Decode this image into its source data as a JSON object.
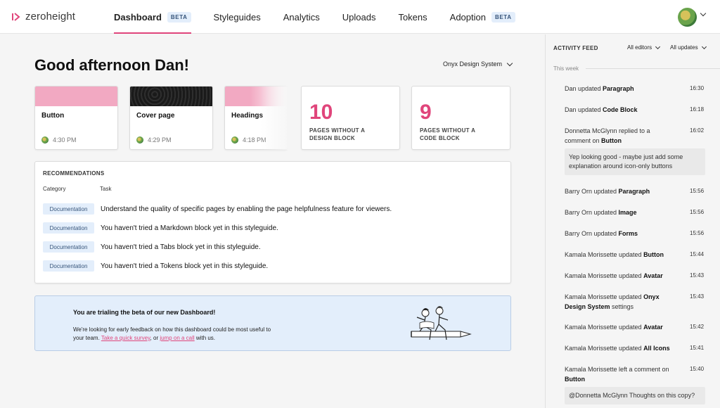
{
  "brand": {
    "name": "zeroheight",
    "accent": "#e0457b"
  },
  "nav": {
    "items": [
      {
        "label": "Dashboard",
        "badge": "BETA",
        "active": true
      },
      {
        "label": "Styleguides",
        "badge": ""
      },
      {
        "label": "Analytics",
        "badge": ""
      },
      {
        "label": "Uploads",
        "badge": ""
      },
      {
        "label": "Tokens",
        "badge": ""
      },
      {
        "label": "Adoption",
        "badge": "BETA"
      }
    ]
  },
  "user": {
    "avatar_icon": "user-avatar"
  },
  "greeting": "Good afternoon Dan!",
  "design_system_select": "Onyx Design System",
  "recent_pages": [
    {
      "title": "Button",
      "time": "4:30 PM",
      "thumb": "pink"
    },
    {
      "title": "Cover page",
      "time": "4:29 PM",
      "thumb": "dark"
    },
    {
      "title": "Headings",
      "time": "4:18 PM",
      "thumb": "pink-fade"
    }
  ],
  "stats": [
    {
      "number": "10",
      "label": "PAGES WITHOUT A DESIGN BLOCK"
    },
    {
      "number": "9",
      "label": "PAGES WITHOUT A CODE BLOCK"
    }
  ],
  "recommendations": {
    "title": "RECOMMENDATIONS",
    "col_category": "Category",
    "col_task": "Task",
    "rows": [
      {
        "category": "Documentation",
        "task": "Understand the quality of specific pages by enabling the page helpfulness feature for viewers."
      },
      {
        "category": "Documentation",
        "task": "You haven't tried a Markdown block yet in this styleguide."
      },
      {
        "category": "Documentation",
        "task": "You haven't tried a Tabs block yet in this styleguide."
      },
      {
        "category": "Documentation",
        "task": "You haven't tried a Tokens block yet in this styleguide."
      }
    ]
  },
  "banner": {
    "title": "You are trialing the beta of our new Dashboard!",
    "text_before": "We're looking for early feedback on how this dashboard could be most useful to your team. ",
    "link1": "Take a quick survey",
    "text_mid": ", or ",
    "link2": "jump on a call",
    "text_after": " with us."
  },
  "feed": {
    "title": "ACTIVITY FEED",
    "filter_editors": "All editors",
    "filter_updates": "All updates",
    "week_label": "This week",
    "items": [
      {
        "pre": "Dan updated ",
        "bold": "Paragraph",
        "post": "",
        "time": "16:30"
      },
      {
        "pre": "Dan updated ",
        "bold": "Code Block",
        "post": "",
        "time": "16:18"
      },
      {
        "pre": "Donnetta McGlynn replied to a comment on ",
        "bold": "Button",
        "post": "",
        "time": "16:02"
      },
      {
        "pre": "Barry Orn updated ",
        "bold": "Paragraph",
        "post": "",
        "time": "15:56"
      },
      {
        "pre": "Barry Orn updated ",
        "bold": "Image",
        "post": "",
        "time": "15:56"
      },
      {
        "pre": "Barry Orn updated ",
        "bold": "Forms",
        "post": "",
        "time": "15:56"
      },
      {
        "pre": "Kamala Morissette updated ",
        "bold": "Button",
        "post": "",
        "time": "15:44"
      },
      {
        "pre": "Kamala Morissette updated ",
        "bold": "Avatar",
        "post": "",
        "time": "15:43"
      },
      {
        "pre": "Kamala Morissette updated ",
        "bold": "Onyx Design System",
        "post": " settings",
        "time": "15:43"
      },
      {
        "pre": "Kamala Morissette updated ",
        "bold": "Avatar",
        "post": "",
        "time": "15:42"
      },
      {
        "pre": "Kamala Morissette updated ",
        "bold": "All Icons",
        "post": "",
        "time": "15:41"
      },
      {
        "pre": "Kamala Morissette left a comment on ",
        "bold": "Button",
        "post": "",
        "time": "15:40"
      }
    ],
    "quote1": "Yep looking good - maybe just add some explanation around icon-only buttons",
    "quote2": "@Donnetta McGlynn Thoughts on this copy?"
  }
}
